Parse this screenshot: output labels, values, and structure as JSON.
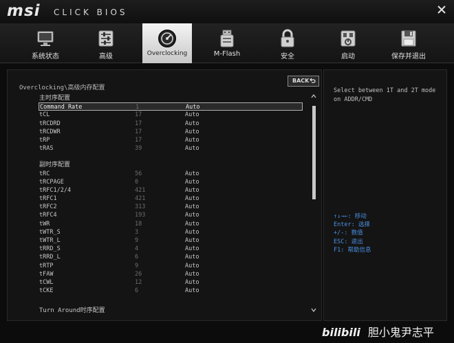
{
  "header": {
    "brand": "msi",
    "subtitle": "CLICK BIOS"
  },
  "nav": {
    "items": [
      {
        "label": "系统状态",
        "icon": "monitor-icon"
      },
      {
        "label": "高级",
        "icon": "settings-sliders-icon"
      },
      {
        "label": "Overclocking",
        "icon": "speedometer-icon",
        "active": true
      },
      {
        "label": "M-Flash",
        "icon": "usb-drive-icon"
      },
      {
        "label": "安全",
        "icon": "lock-icon"
      },
      {
        "label": "启动",
        "icon": "boot-icon"
      },
      {
        "label": "保存并退出",
        "icon": "floppy-icon"
      }
    ]
  },
  "main": {
    "breadcrumb": "Overclocking\\高级内存配置",
    "back_label": "BACK",
    "primary_section": "主时序配置",
    "primary": [
      {
        "name": "Command Rate",
        "value": "1",
        "mode": "Auto"
      },
      {
        "name": "tCL",
        "value": "17",
        "mode": "Auto"
      },
      {
        "name": "tRCDRD",
        "value": "17",
        "mode": "Auto"
      },
      {
        "name": "tRCDWR",
        "value": "17",
        "mode": "Auto"
      },
      {
        "name": "tRP",
        "value": "17",
        "mode": "Auto"
      },
      {
        "name": "tRAS",
        "value": "39",
        "mode": "Auto"
      }
    ],
    "secondary_section": "副时序配置",
    "secondary": [
      {
        "name": "tRC",
        "value": "56",
        "mode": "Auto"
      },
      {
        "name": "tRCPAGE",
        "value": "0",
        "mode": "Auto"
      },
      {
        "name": "tRFC1/2/4",
        "value": "421",
        "mode": "Auto"
      },
      {
        "name": "tRFC1",
        "value": "421",
        "mode": "Auto"
      },
      {
        "name": "tRFC2",
        "value": "313",
        "mode": "Auto"
      },
      {
        "name": "tRFC4",
        "value": "193",
        "mode": "Auto"
      },
      {
        "name": "tWR",
        "value": "18",
        "mode": "Auto"
      },
      {
        "name": "tWTR_S",
        "value": "3",
        "mode": "Auto"
      },
      {
        "name": "tWTR_L",
        "value": "9",
        "mode": "Auto"
      },
      {
        "name": "tRRD_S",
        "value": "4",
        "mode": "Auto"
      },
      {
        "name": "tRRD_L",
        "value": "6",
        "mode": "Auto"
      },
      {
        "name": "tRTP",
        "value": "9",
        "mode": "Auto"
      },
      {
        "name": "tFAW",
        "value": "26",
        "mode": "Auto"
      },
      {
        "name": "tCWL",
        "value": "12",
        "mode": "Auto"
      },
      {
        "name": "tCKE",
        "value": "6",
        "mode": "Auto"
      }
    ],
    "turnaround_section": "Turn Around时序配置"
  },
  "help": {
    "description": "Select between 1T and 2T mode on ADDR/CMD",
    "keys": [
      "↑↓→←: 移动",
      "Enter: 选择",
      "+/-: 数值",
      "ESC: 退出",
      "F1: 帮助信息"
    ]
  },
  "watermark": {
    "platform": "bilibili",
    "author": "胆小鬼尹志平"
  },
  "colors": {
    "background": "#0c0c0c",
    "panel": "#141414",
    "key_help": "#4a90e2",
    "active_tab": "#e8e8e8"
  }
}
